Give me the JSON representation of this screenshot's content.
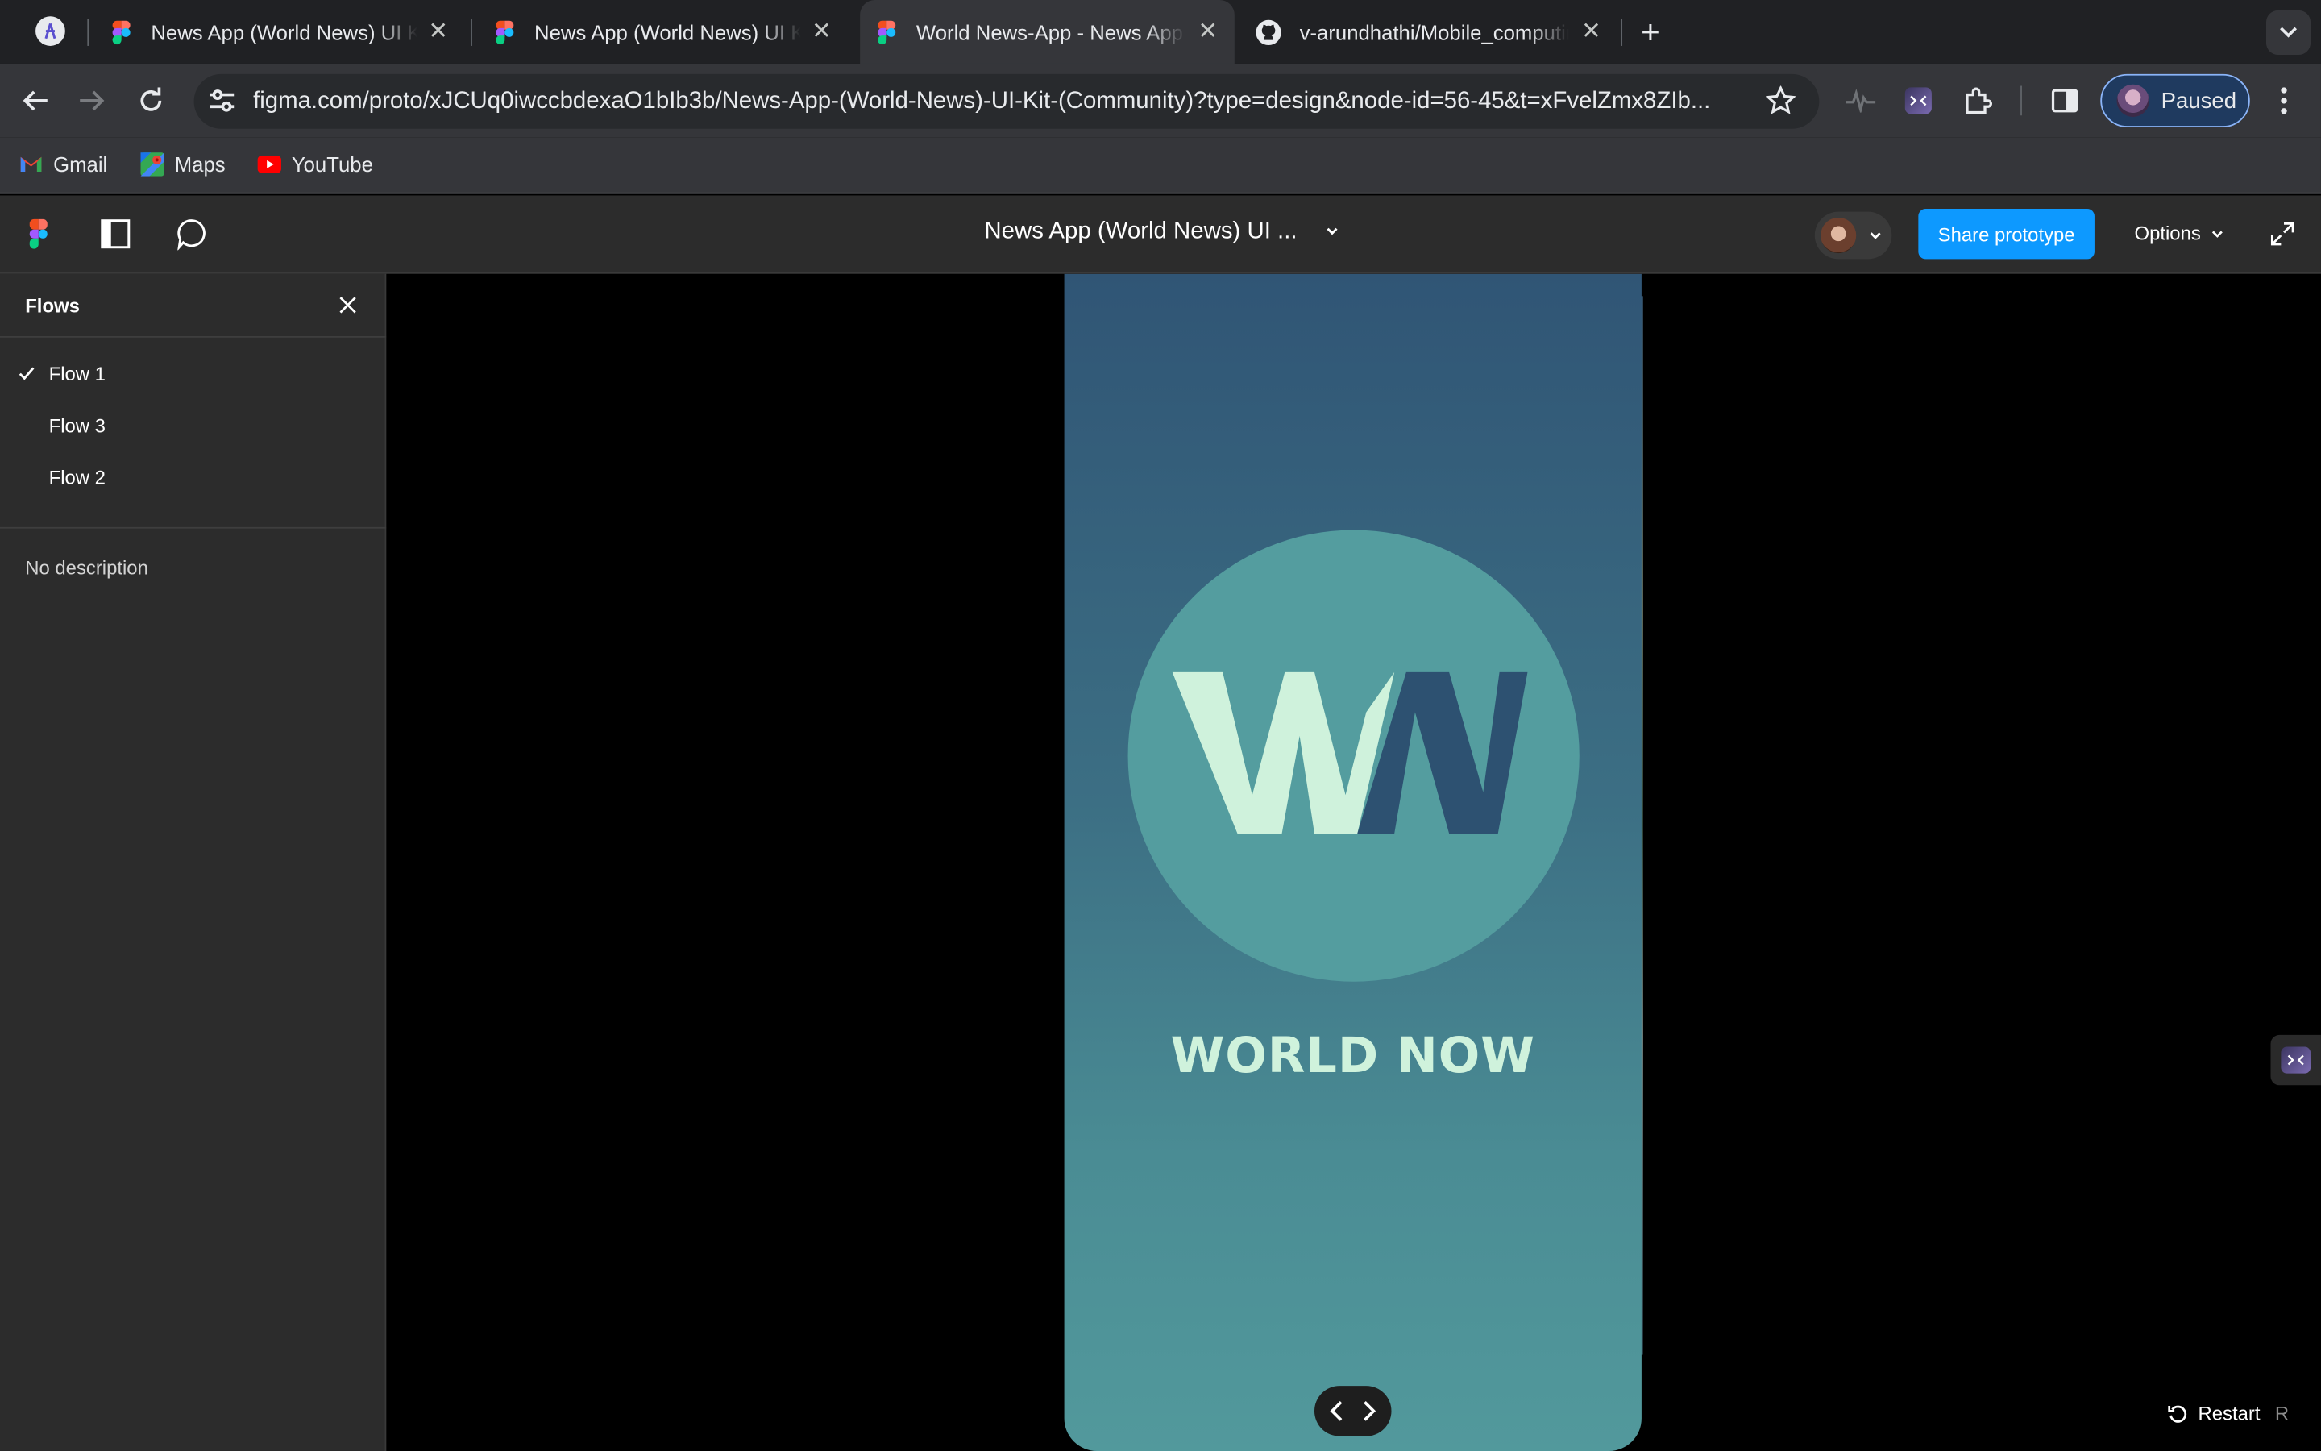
{
  "browser": {
    "tabs": [
      {
        "title": "News App (World News) UI Kit (Community)",
        "active": false
      },
      {
        "title": "News App (World News) UI Kit (Community)",
        "active": false
      },
      {
        "title": "World News-App - News App (World News) UI Kit",
        "active": true
      },
      {
        "title": "v-arundhathi/Mobile_computing",
        "active": false
      }
    ],
    "url": "figma.com/proto/xJCUq0iwccbdexaO1bIb3b/News-App-(World-News)-UI-Kit-(Community)?type=design&node-id=56-45&t=xFvelZmx8ZIb...",
    "profile_label": "Paused",
    "bookmarks": [
      "Gmail",
      "Maps",
      "YouTube"
    ]
  },
  "figma": {
    "file_title": "News App (World News) UI ...",
    "share_label": "Share prototype",
    "options_label": "Options"
  },
  "sidebar": {
    "title": "Flows",
    "flows": [
      {
        "label": "Flow 1",
        "selected": true
      },
      {
        "label": "Flow 3",
        "selected": false
      },
      {
        "label": "Flow 2",
        "selected": false
      }
    ],
    "description": "No description"
  },
  "prototype": {
    "logo_letters": "WN",
    "brand_name": "WORLD NOW",
    "colors": {
      "gradient_top": "#305575",
      "gradient_bottom": "#52999c",
      "circle": "#549d9f",
      "logo_w": "#cff2dc",
      "logo_n": "#2d5171"
    }
  },
  "controls": {
    "restart_label": "Restart",
    "restart_shortcut": "R"
  }
}
